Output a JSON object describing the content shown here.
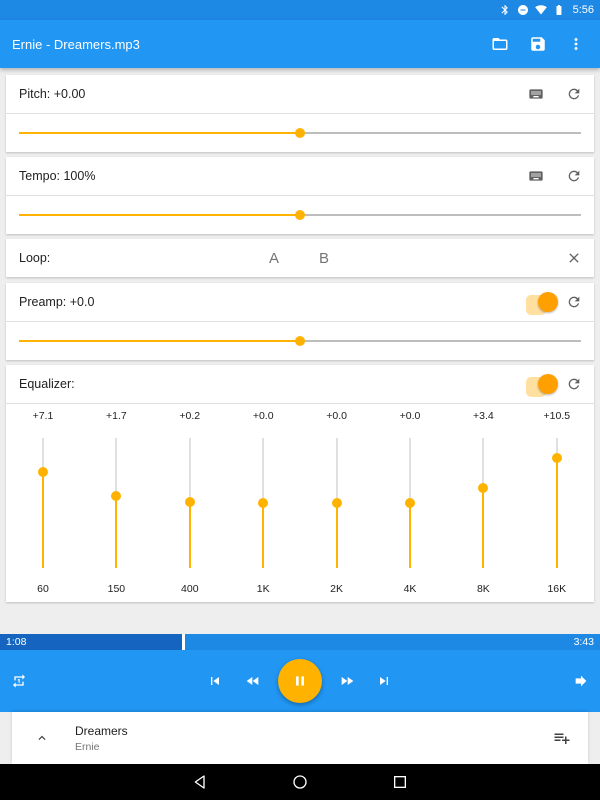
{
  "status": {
    "time": "5:56",
    "icons": [
      "bluetooth-icon",
      "do-not-disturb-icon",
      "wifi-icon",
      "battery-icon"
    ]
  },
  "app_bar": {
    "title": "Ernie - Dreamers.mp3",
    "actions": [
      "folder-icon",
      "save-icon",
      "more-vert-icon"
    ]
  },
  "pitch": {
    "label": "Pitch: +0.00",
    "value": 0.5
  },
  "tempo": {
    "label": "Tempo: 100%",
    "value": 0.5
  },
  "loop": {
    "label": "Loop:",
    "a": "A",
    "b": "B"
  },
  "preamp": {
    "label": "Preamp: +0.0",
    "enabled": true,
    "value": 0.5
  },
  "equalizer": {
    "label": "Equalizer:",
    "enabled": true,
    "bands": [
      {
        "value": "+7.1",
        "freq": "60",
        "level": 7.1
      },
      {
        "value": "+1.7",
        "freq": "150",
        "level": 1.7
      },
      {
        "value": "+0.2",
        "freq": "400",
        "level": 0.2
      },
      {
        "value": "+0.0",
        "freq": "1K",
        "level": 0.0
      },
      {
        "value": "+0.0",
        "freq": "2K",
        "level": 0.0
      },
      {
        "value": "+0.0",
        "freq": "4K",
        "level": 0.0
      },
      {
        "value": "+3.4",
        "freq": "8K",
        "level": 3.4
      },
      {
        "value": "+10.5",
        "freq": "16K",
        "level": 10.5
      }
    ],
    "range": [
      -15,
      15
    ]
  },
  "playback": {
    "elapsed": "1:08",
    "duration": "3:43",
    "progress": 0.305
  },
  "now_playing": {
    "title": "Dreamers",
    "artist": "Ernie"
  },
  "colors": {
    "primary": "#2196f3",
    "primary_dark": "#1e88e5",
    "accent": "#ffb300"
  }
}
